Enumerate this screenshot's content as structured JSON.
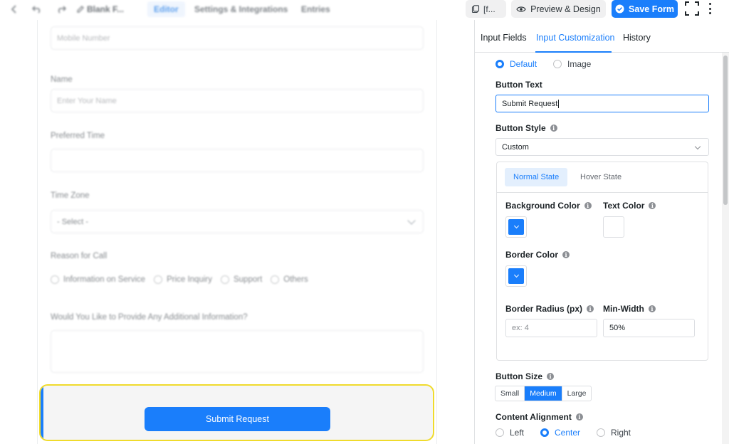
{
  "topbar": {
    "form_title": "Blank F...",
    "tabs": [
      {
        "label": "Editor",
        "active": true
      },
      {
        "label": "Settings & Integrations",
        "active": false
      },
      {
        "label": "Entries",
        "active": false
      }
    ],
    "shortcode_label": "[f...",
    "preview_label": "Preview & Design",
    "save_label": "Save Form"
  },
  "form": {
    "mobile_placeholder": "Mobile Number",
    "name_label": "Name",
    "name_placeholder": "Enter Your Name",
    "preferred_time_label": "Preferred Time",
    "time_zone_label": "Time Zone",
    "time_zone_value": "- Select -",
    "reason_label": "Reason for Call",
    "reason_options": [
      "Information on Service",
      "Price Inquiry",
      "Support",
      "Others"
    ],
    "additional_label": "Would You Like to Provide Any Additional Information?",
    "submit_label": "Submit Request"
  },
  "panel": {
    "tabs": [
      {
        "label": "Input Fields",
        "active": false
      },
      {
        "label": "Input Customization",
        "active": true
      },
      {
        "label": "History",
        "active": false
      }
    ],
    "button_type_options": [
      {
        "label": "Default",
        "selected": true
      },
      {
        "label": "Image",
        "selected": false
      }
    ],
    "button_text_label": "Button Text",
    "button_text_value": "Submit Request",
    "button_style_label": "Button Style",
    "button_style_value": "Custom",
    "state_tabs": [
      {
        "label": "Normal State",
        "active": true
      },
      {
        "label": "Hover State",
        "active": false
      }
    ],
    "background_color_label": "Background Color",
    "text_color_label": "Text Color",
    "border_color_label": "Border Color",
    "border_radius_label": "Border Radius (px)",
    "border_radius_placeholder": "ex: 4",
    "min_width_label": "Min-Width",
    "min_width_value": "50%",
    "button_size_label": "Button Size",
    "sizes": [
      {
        "label": "Small",
        "selected": false
      },
      {
        "label": "Medium",
        "selected": true
      },
      {
        "label": "Large",
        "selected": false
      }
    ],
    "content_alignment_label": "Content Alignment",
    "alignments": [
      {
        "label": "Left",
        "selected": false
      },
      {
        "label": "Center",
        "selected": true
      },
      {
        "label": "Right",
        "selected": false
      }
    ]
  },
  "colors": {
    "accent": "#1a7efb",
    "background_color": "#1a7efb",
    "text_color": "#ffffff",
    "border_color": "#1a7efb",
    "highlight_border": "#f0db2c"
  }
}
